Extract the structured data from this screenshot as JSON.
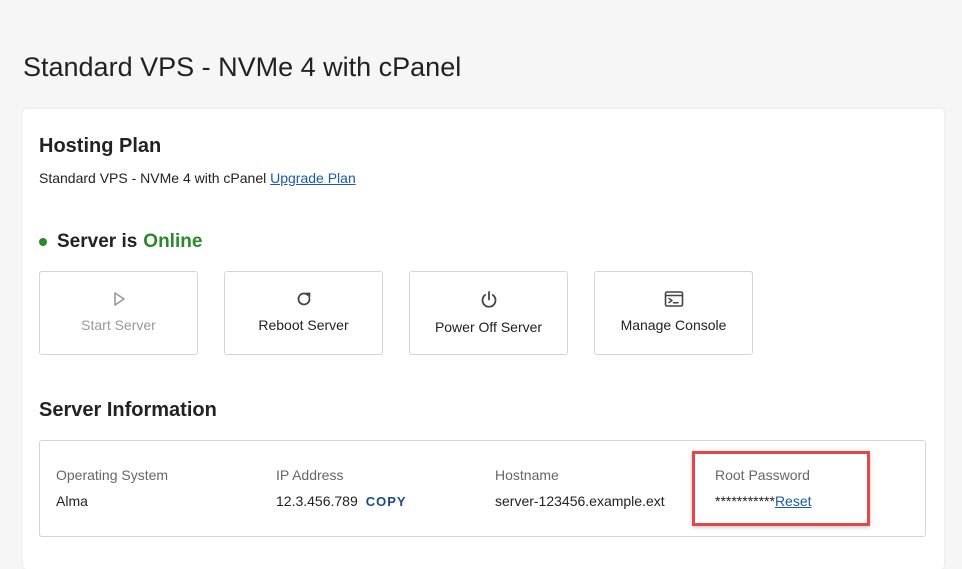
{
  "page": {
    "title": "Standard VPS - NVMe 4 with cPanel"
  },
  "hosting_plan": {
    "title": "Hosting Plan",
    "plan_name": "Standard VPS - NVMe 4 with cPanel",
    "upgrade_link": "Upgrade Plan"
  },
  "server_status": {
    "prefix": "Server is",
    "status": "Online",
    "status_color": "#2a8a2a"
  },
  "actions": [
    {
      "label": "Start Server",
      "icon": "play-icon",
      "disabled": true
    },
    {
      "label": "Reboot Server",
      "icon": "refresh-icon",
      "disabled": false
    },
    {
      "label": "Power Off Server",
      "icon": "power-icon",
      "disabled": false
    },
    {
      "label": "Manage Console",
      "icon": "terminal-icon",
      "disabled": false
    }
  ],
  "server_info": {
    "title": "Server Information",
    "os_label": "Operating System",
    "os_value": "Alma",
    "ip_label": "IP Address",
    "ip_value": "12.3.456.789",
    "copy_label": "COPY",
    "hostname_label": "Hostname",
    "hostname_value": "server-123456.example.ext",
    "root_pw_label": "Root Password",
    "root_pw_value": "***********",
    "reset_label": "Reset"
  },
  "colors": {
    "link": "#1a5aa6",
    "highlight": "#e0484a"
  }
}
